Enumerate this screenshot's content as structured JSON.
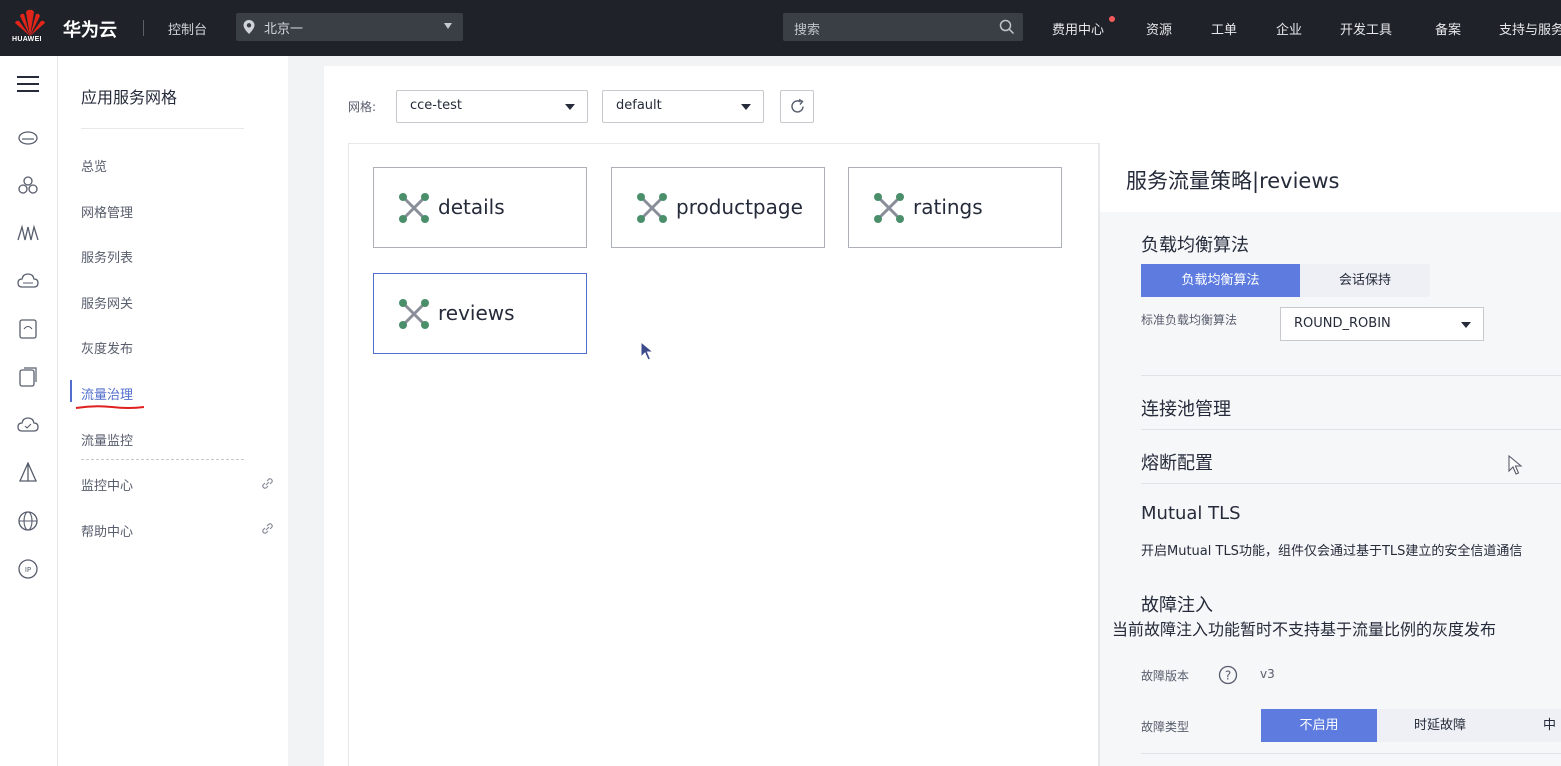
{
  "topbar": {
    "logo_text": "HUAWEI",
    "brand": "华为云",
    "console": "控制台",
    "region": "北京一",
    "search_placeholder": "搜索",
    "nav": [
      "费用中心",
      "资源",
      "工单",
      "企业",
      "开发工具",
      "备案",
      "支持与服务"
    ]
  },
  "subnav": {
    "title": "应用服务网格",
    "items": [
      "总览",
      "网格管理",
      "服务列表",
      "服务网关",
      "灰度发布",
      "流量治理",
      "流量监控"
    ],
    "active_index": 5,
    "external": [
      "监控中心",
      "帮助中心"
    ]
  },
  "toolbar": {
    "mesh_label": "网格:",
    "mesh_value": "cce-test",
    "namespace_value": "default"
  },
  "services": [
    {
      "name": "details"
    },
    {
      "name": "productpage"
    },
    {
      "name": "ratings"
    },
    {
      "name": "reviews",
      "selected": true
    }
  ],
  "panel": {
    "title": "服务流量策略|reviews",
    "lb": {
      "title": "负载均衡算法",
      "tabs": [
        "负载均衡算法",
        "会话保持"
      ],
      "active_tab": 0,
      "algo_label": "标准负载均衡算法",
      "algo_value": "ROUND_ROBIN"
    },
    "pool_title": "连接池管理",
    "breaker_title": "熔断配置",
    "mtls": {
      "title": "Mutual TLS",
      "desc": "开启Mutual TLS功能，组件仅会通过基于TLS建立的安全信道通信"
    },
    "fault": {
      "title": "故障注入",
      "desc": "当前故障注入功能暂时不支持基于流量比例的灰度发布",
      "version_label": "故障版本",
      "version_value": "v3",
      "type_label": "故障类型",
      "types": [
        "不启用",
        "时延故障",
        "中断故障"
      ],
      "active_type": 0
    }
  },
  "colors": {
    "topbar": "#1f2329",
    "accent": "#526ecc",
    "tab_active": "#5e7ce0",
    "node_green": "#4a8f6a",
    "annotation_red": "#e02020"
  }
}
